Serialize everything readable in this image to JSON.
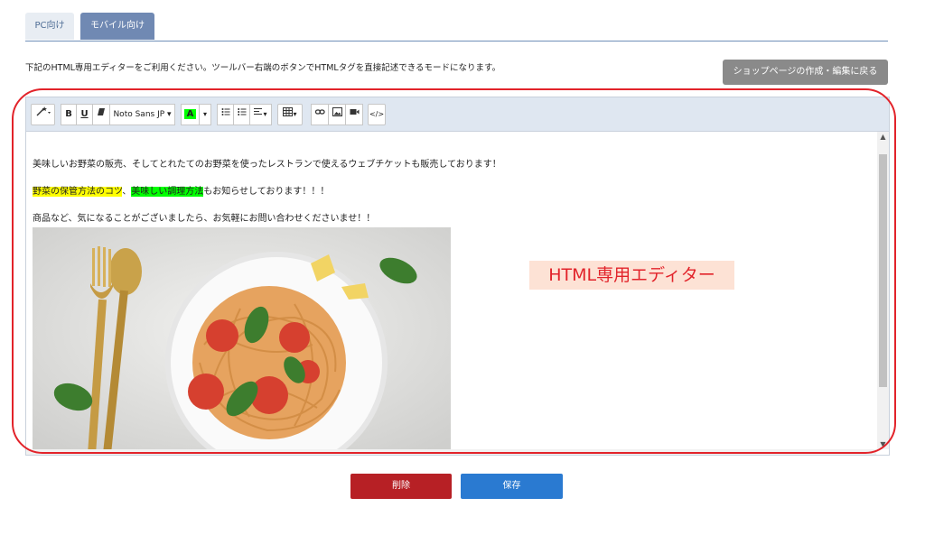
{
  "tabs": [
    {
      "label": "PC向け",
      "active": false
    },
    {
      "label": "モバイル向け",
      "active": true
    }
  ],
  "description": "下記のHTML専用エディターをご利用ください。ツールバー右端のボタンでHTMLタグを直接記述できるモードになります。",
  "back_button": "ショップページの作成・編集に戻る",
  "toolbar": {
    "magic_icon": "wand-icon",
    "bold": "B",
    "underline": "U",
    "font_family": "Noto Sans JP",
    "color_letter": "A",
    "color_highlight": "#00ff00",
    "code": "</>"
  },
  "editor": {
    "line1": "美味しいお野菜の販売、そしてとれたてのお野菜を使ったレストランで使えるウェブチケットも販売しております！",
    "line2_yellow": "野菜の保管方法のコツ",
    "line2_sep": "、",
    "line2_green": "美味しい調理方法",
    "line2_tail": "もお知らせしております！！！",
    "line3": "商品など、気になることがございましたら、お気軽にお問い合わせくださいませ！！",
    "image_alt": "pasta-photo"
  },
  "annotation": "HTML専用エディター",
  "buttons": {
    "delete": "削除",
    "save": "保存"
  },
  "colors": {
    "tab_active": "#7089b3",
    "delete": "#b72025",
    "save": "#2a7ad1",
    "annotation": "#e2232a"
  }
}
